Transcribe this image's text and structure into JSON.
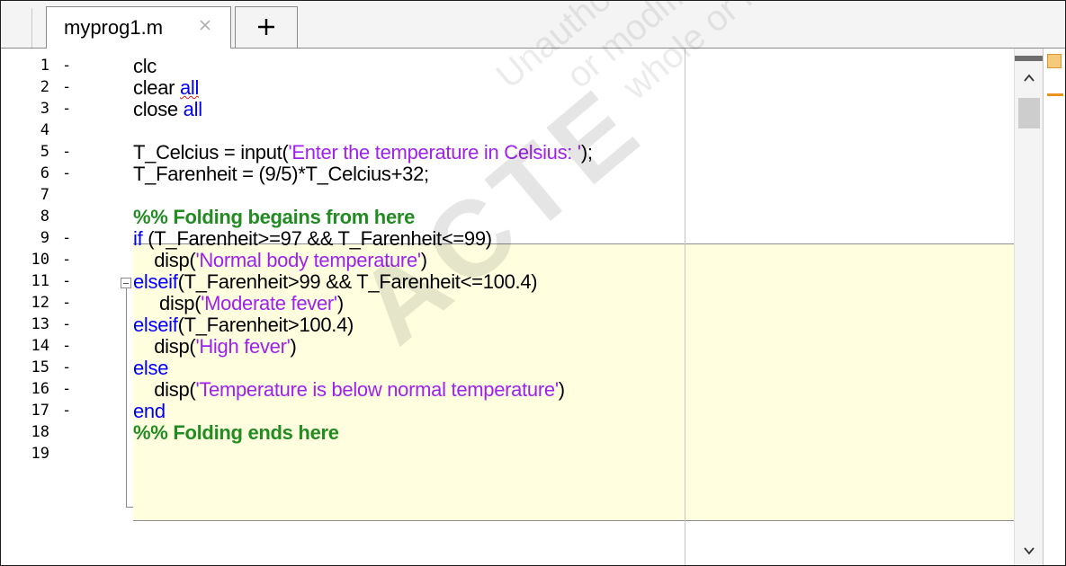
{
  "tab": {
    "filename": "myprog1.m",
    "new_tab_label": "+"
  },
  "lines": [
    {
      "number": "1",
      "bp": "-",
      "segments": [
        [
          "",
          "clc"
        ]
      ]
    },
    {
      "number": "2",
      "bp": "-",
      "segments": [
        [
          "",
          "clear "
        ],
        [
          "kw squiggle",
          "all"
        ]
      ]
    },
    {
      "number": "3",
      "bp": "-",
      "segments": [
        [
          "",
          "close "
        ],
        [
          "kw",
          "all"
        ]
      ]
    },
    {
      "number": "4",
      "bp": "",
      "segments": []
    },
    {
      "number": "5",
      "bp": "-",
      "segments": [
        [
          "",
          "T_Celcius = input("
        ],
        [
          "str",
          "'Enter the temperature in Celsius: '"
        ],
        [
          "",
          ");"
        ]
      ]
    },
    {
      "number": "6",
      "bp": "-",
      "segments": [
        [
          "",
          "T_Farenheit = (9/5)*T_Celcius+32;"
        ]
      ]
    },
    {
      "number": "7",
      "bp": "",
      "segments": []
    },
    {
      "number": "8",
      "bp": "",
      "segments": [
        [
          "cm",
          "%% Folding begains from here"
        ]
      ]
    },
    {
      "number": "9",
      "bp": "-",
      "segments": [
        [
          "kw",
          "if"
        ],
        [
          "",
          " (T_Farenheit>=97 && T_Farenheit<=99)"
        ]
      ]
    },
    {
      "number": "10",
      "bp": "-",
      "segments": [
        [
          "",
          "    disp("
        ],
        [
          "str",
          "'Normal body temperature'"
        ],
        [
          "",
          ")"
        ]
      ]
    },
    {
      "number": "11",
      "bp": "-",
      "segments": [
        [
          "kw",
          "elseif"
        ],
        [
          "",
          "(T_Farenheit>99 && T_Farenheit<=100.4)"
        ]
      ]
    },
    {
      "number": "12",
      "bp": "-",
      "segments": [
        [
          "",
          "     disp("
        ],
        [
          "str",
          "'Moderate fever'"
        ],
        [
          "",
          ")"
        ]
      ]
    },
    {
      "number": "13",
      "bp": "-",
      "segments": [
        [
          "kw",
          "elseif"
        ],
        [
          "",
          "(T_Farenheit>100.4)"
        ]
      ]
    },
    {
      "number": "14",
      "bp": "-",
      "segments": [
        [
          "",
          "    disp("
        ],
        [
          "str",
          "'High fever'"
        ],
        [
          "",
          ")"
        ]
      ]
    },
    {
      "number": "15",
      "bp": "-",
      "segments": [
        [
          "kw",
          "else"
        ]
      ]
    },
    {
      "number": "16",
      "bp": "-",
      "segments": [
        [
          "",
          "    disp("
        ],
        [
          "str",
          "'Temperature is below normal temperature'"
        ],
        [
          "",
          ")"
        ]
      ]
    },
    {
      "number": "17",
      "bp": "-",
      "segments": [
        [
          "kw",
          "end"
        ]
      ]
    },
    {
      "number": "18",
      "bp": "",
      "segments": [
        [
          "cm",
          "%% Folding ends here"
        ]
      ]
    },
    {
      "number": "19",
      "bp": "",
      "segments": []
    }
  ],
  "watermark": {
    "logo": "ACTE",
    "text_lines": [
      "Unauthorized reproduction, distribution, copying of this document",
      "or modification, or republication of this",
      "whole or in part, is strictly prohibited."
    ]
  },
  "icons": {
    "tab_close": "close-icon",
    "new_tab": "plus-icon",
    "fold": "fold-collapse-icon",
    "scroll_up": "chevron-up-icon",
    "scroll_down": "chevron-down-icon",
    "analyzer": "code-analyzer-indicator-icon"
  },
  "colors": {
    "keyword": "#0000ff",
    "string": "#a020f0",
    "comment": "#228b22",
    "fold_background": "#ffffe0"
  }
}
